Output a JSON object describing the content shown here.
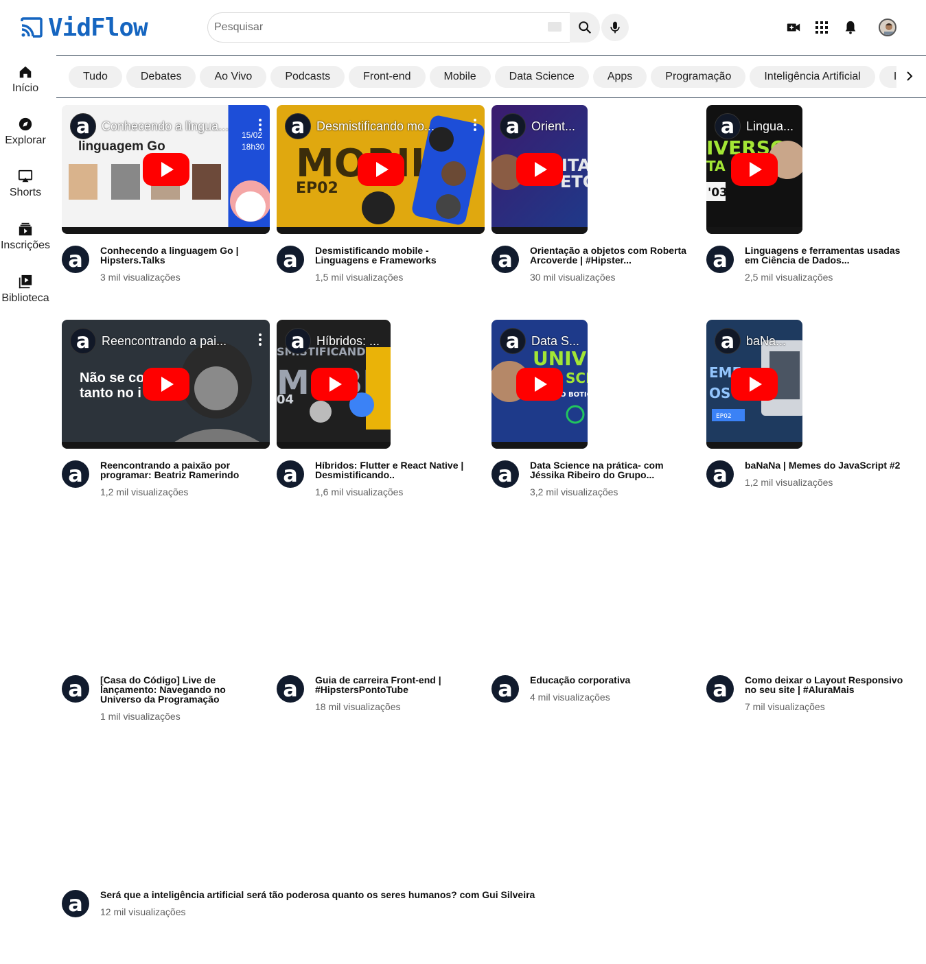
{
  "app": {
    "name": "VidFlow"
  },
  "search": {
    "placeholder": "Pesquisar"
  },
  "icons": {
    "logo": "cast-icon",
    "search": "search-icon",
    "mic": "mic-icon",
    "create": "video-add-icon",
    "apps": "apps-grid-icon",
    "notifications": "bell-icon",
    "next": "chevron-right-icon"
  },
  "sidebar": {
    "items": [
      {
        "label": "Início",
        "icon": "home-icon"
      },
      {
        "label": "Explorar",
        "icon": "compass-icon"
      },
      {
        "label": "Shorts",
        "icon": "shorts-icon"
      },
      {
        "label": "Inscrições",
        "icon": "subscriptions-icon"
      },
      {
        "label": "Biblioteca",
        "icon": "library-icon"
      }
    ]
  },
  "chips": [
    "Tudo",
    "Debates",
    "Ao Vivo",
    "Podcasts",
    "Front-end",
    "Mobile",
    "Data Science",
    "Apps",
    "Programação",
    "Inteligência Artificial",
    "Inovação"
  ],
  "videos": [
    {
      "thumb_title": "Conhecendo a lingua...",
      "title": "Conhecendo a linguagem Go | Hipsters.Talks",
      "views": "3 mil visualizações"
    },
    {
      "thumb_title": "Desmistificando mo...",
      "title": "Desmistificando mobile - Linguagens e Frameworks",
      "views": "1,5 mil visualizações"
    },
    {
      "thumb_title": "Orient...",
      "title": "Orientação a objetos com Roberta Arcoverde | #Hipster...",
      "views": "30 mil visualizações"
    },
    {
      "thumb_title": "Lingua...",
      "title": "Linguagens e ferramentas usadas em Ciência de Dados...",
      "views": "2,5 mil visualizações"
    },
    {
      "thumb_title": "Reencontrando a pai...",
      "title": "Reencontrando a paixão por programar: Beatriz Ramerindo",
      "views": "1,2 mil visualizações"
    },
    {
      "thumb_title": "Híbridos: ...",
      "title": "Híbridos: Flutter e React Native | Desmistificando..",
      "views": "1,6 mil visualizações"
    },
    {
      "thumb_title": "Data S...",
      "title": "Data Science na prática- com Jéssika Ribeiro do Grupo...",
      "views": "3,2 mil visualizações"
    },
    {
      "thumb_title": "baNa...",
      "title": "baNaNa | Memes do JavaScript #2",
      "views": "1,2 mil visualizações"
    },
    {
      "thumb_title": "",
      "title": "[Casa do Código] Live de lançamento: Navegando no Universo da Programação",
      "views": "1 mil visualizações"
    },
    {
      "thumb_title": "",
      "title": "Guia de carreira Front-end | #HipstersPontoTube",
      "views": "18 mil visualizações"
    },
    {
      "thumb_title": "",
      "title": "Educação corporativa",
      "views": "4 mil visualizações"
    },
    {
      "thumb_title": "",
      "title": "Como deixar o Layout Responsivo no seu site | #AluraMais",
      "views": "7 mil visualizações"
    },
    {
      "thumb_title": "",
      "title": "Será que a inteligência artificial será tão poderosa quanto os seres humanos? com Gui Silveira",
      "views": "12 mil visualizações"
    }
  ],
  "colors": {
    "brand": "#1565c0",
    "play": "#ff0000",
    "chip_bg": "#f0f0f0"
  }
}
